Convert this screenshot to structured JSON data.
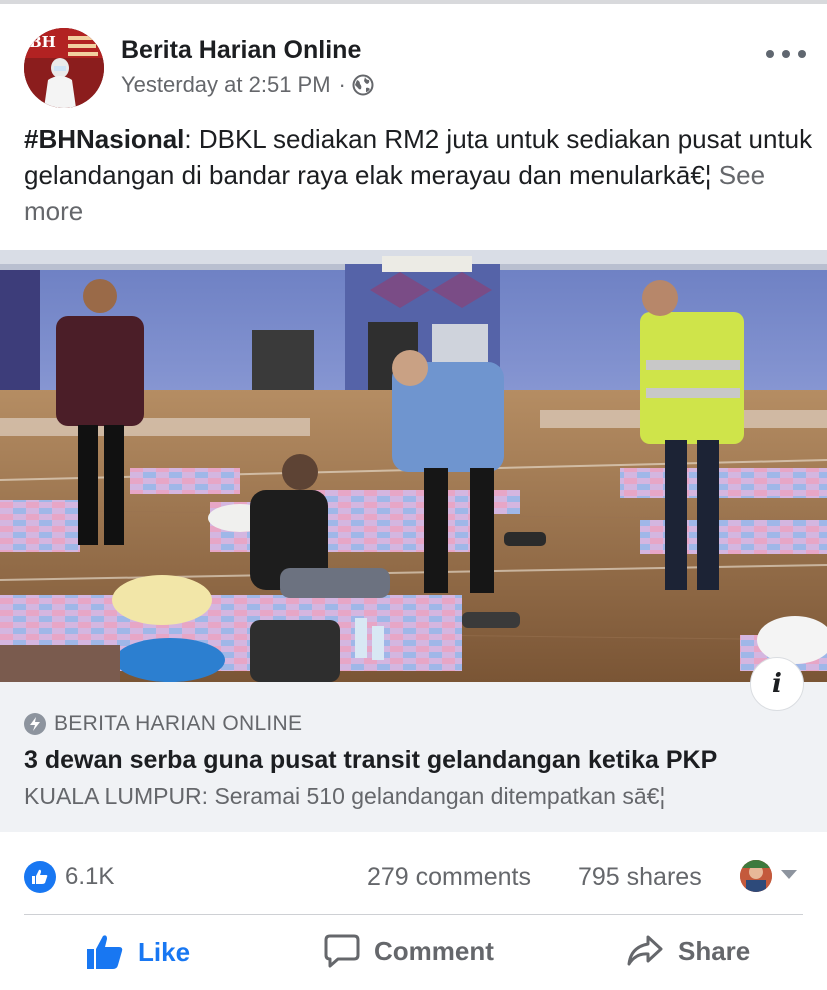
{
  "post": {
    "page_name": "Berita Harian Online",
    "timestamp": "Yesterday at 2:51 PM",
    "separator": "·",
    "audience_icon": "globe-icon",
    "more_icon": "more-options-icon",
    "avatar_text": "BH"
  },
  "body": {
    "hashtag": "#BHNasional",
    "text": ": DBKL sediakan RM2 juta untuk sediakan pusat untuk gelandangan di bandar raya elak merayau dan menularkā€¦",
    "see_more": "See more"
  },
  "link_preview": {
    "source": "BERITA HARIAN ONLINE",
    "source_icon": "bolt-icon",
    "title": "3 dewan serba guna pusat transit gelandangan ketika PKP",
    "description": "KUALA LUMPUR: Seramai 510 gelandangan ditempatkan sā€¦",
    "info_label": "i"
  },
  "stats": {
    "reactions": "6.1K",
    "comments": "279 comments",
    "shares": "795 shares"
  },
  "actions": {
    "like": "Like",
    "comment": "Comment",
    "share": "Share"
  },
  "colors": {
    "accent": "#1877f2",
    "secondary_text": "#65676b",
    "primary_text": "#1c1e21",
    "preview_bg": "#f0f2f5"
  }
}
